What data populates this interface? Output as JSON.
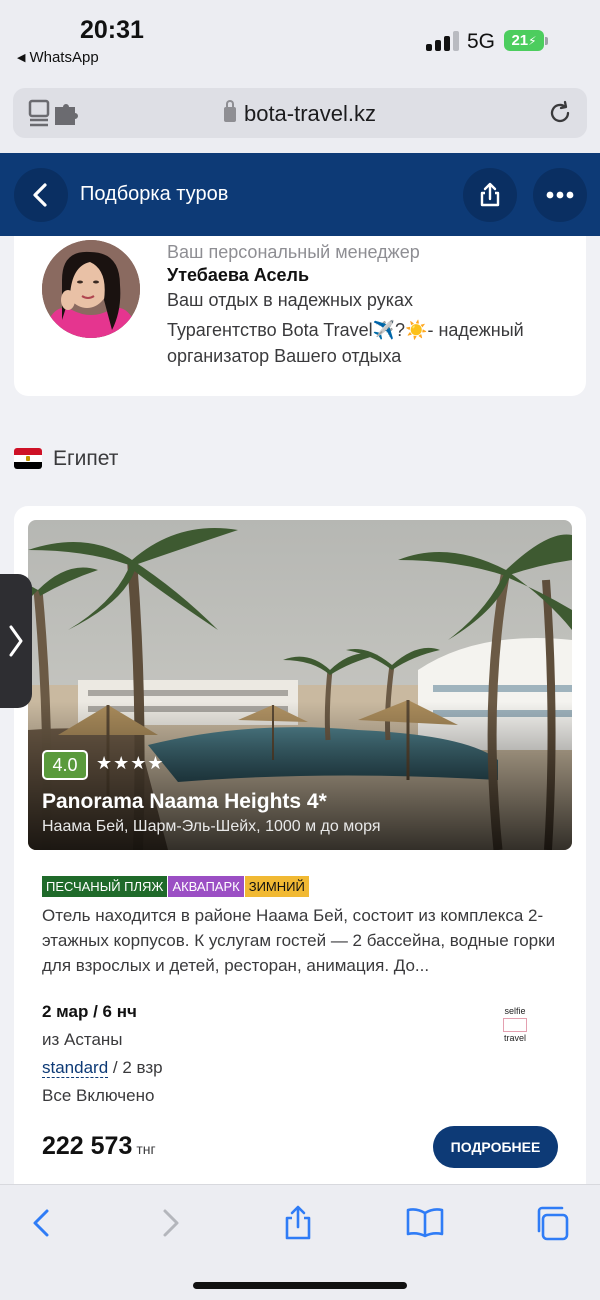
{
  "status_bar": {
    "time": "20:31",
    "back_app": "WhatsApp",
    "network": "5G",
    "battery": "21"
  },
  "browser": {
    "url": "bota-travel.kz"
  },
  "header": {
    "title": "Подборка туров"
  },
  "manager": {
    "role": "Ваш персональный менеджер",
    "name": "Утебаева Асель",
    "tagline": "Ваш отдых в надежных руках",
    "description": "Турагентство Bota Travel✈️?☀️- надежный организатор Вашего отдыха"
  },
  "country": {
    "name": "Египет",
    "flag_colors": [
      "#ce1126",
      "#ffffff",
      "#000000"
    ]
  },
  "hotel": {
    "rating": "4.0",
    "stars": "★★★★",
    "star_count": 4,
    "name": "Panorama Naama Heights 4*",
    "location": "Наама Бей, Шарм-Эль-Шейх, 1000 м до моря",
    "tags": [
      {
        "label": "ПЕСЧАНЫЙ ПЛЯЖ",
        "color": "#1f6a2a"
      },
      {
        "label": "АКВАПАРК",
        "color": "#9b4fc4"
      },
      {
        "label": "ЗИМНИЙ",
        "color": "#f1b933"
      }
    ],
    "description": "Отель находится в районе Наама Бей, состоит из комплекса 2-этажных корпусов. К услугам гостей — 2 бассейна, водные горки для взрослых и детей, ресторан, анимация. До...",
    "dates": "2 мар / 6 нч",
    "departure": "из Астаны",
    "room_type": "standard",
    "guests": " / 2 взр",
    "meal": "Все Включено",
    "operator_top": "selfie",
    "operator_bottom": "travel",
    "price": "222 573",
    "currency": "тнг",
    "details_label": "ПОДРОБНЕЕ"
  },
  "colors": {
    "brand_navy": "#0d3a76",
    "page_bg": "#f0f1f5",
    "ios_blue": "#2f7cf6"
  }
}
